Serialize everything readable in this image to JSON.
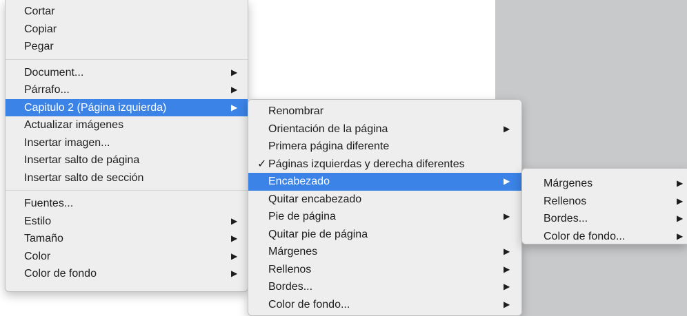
{
  "main_menu": {
    "group1": [
      "Cortar",
      "Copiar",
      "Pegar"
    ],
    "group2": [
      {
        "label": "Document...",
        "submenu": true
      },
      {
        "label": "Párrafo...",
        "submenu": true
      },
      {
        "label": "Capitulo 2 (Página izquierda)",
        "submenu": true,
        "active": true
      },
      {
        "label": "Actualizar imágenes",
        "submenu": false
      },
      {
        "label": "Insertar imagen...",
        "submenu": false
      },
      {
        "label": "Insertar salto de página",
        "submenu": false
      },
      {
        "label": "Insertar salto de sección",
        "submenu": false
      }
    ],
    "group3": [
      {
        "label": "Fuentes...",
        "submenu": false
      },
      {
        "label": "Estilo",
        "submenu": true
      },
      {
        "label": "Tamaño",
        "submenu": true
      },
      {
        "label": "Color",
        "submenu": true
      },
      {
        "label": "Color de fondo",
        "submenu": true
      }
    ]
  },
  "sub_menu": [
    {
      "label": "Renombrar",
      "submenu": false
    },
    {
      "label": "Orientación de la página",
      "submenu": true
    },
    {
      "label": "Primera página diferente",
      "submenu": false
    },
    {
      "label": "Páginas izquierdas y derecha diferentes",
      "submenu": false,
      "checked": true
    },
    {
      "label": "Encabezado",
      "submenu": true,
      "active": true
    },
    {
      "label": "Quitar encabezado",
      "submenu": false
    },
    {
      "label": "Pie de página",
      "submenu": true
    },
    {
      "label": "Quitar pie de página",
      "submenu": false
    },
    {
      "label": "Márgenes",
      "submenu": true
    },
    {
      "label": "Rellenos",
      "submenu": true
    },
    {
      "label": "Bordes...",
      "submenu": true
    },
    {
      "label": "Color de fondo...",
      "submenu": true
    }
  ],
  "sub_sub_menu": [
    {
      "label": "Márgenes",
      "submenu": true
    },
    {
      "label": "Rellenos",
      "submenu": true
    },
    {
      "label": "Bordes...",
      "submenu": true
    },
    {
      "label": "Color de fondo...",
      "submenu": true
    }
  ],
  "glyphs": {
    "arrow": "▶",
    "check": "✓"
  },
  "colors": {
    "highlight": "#3b83e6",
    "menu_bg": "#eeeeee",
    "background_right": "#c8c9cb"
  }
}
